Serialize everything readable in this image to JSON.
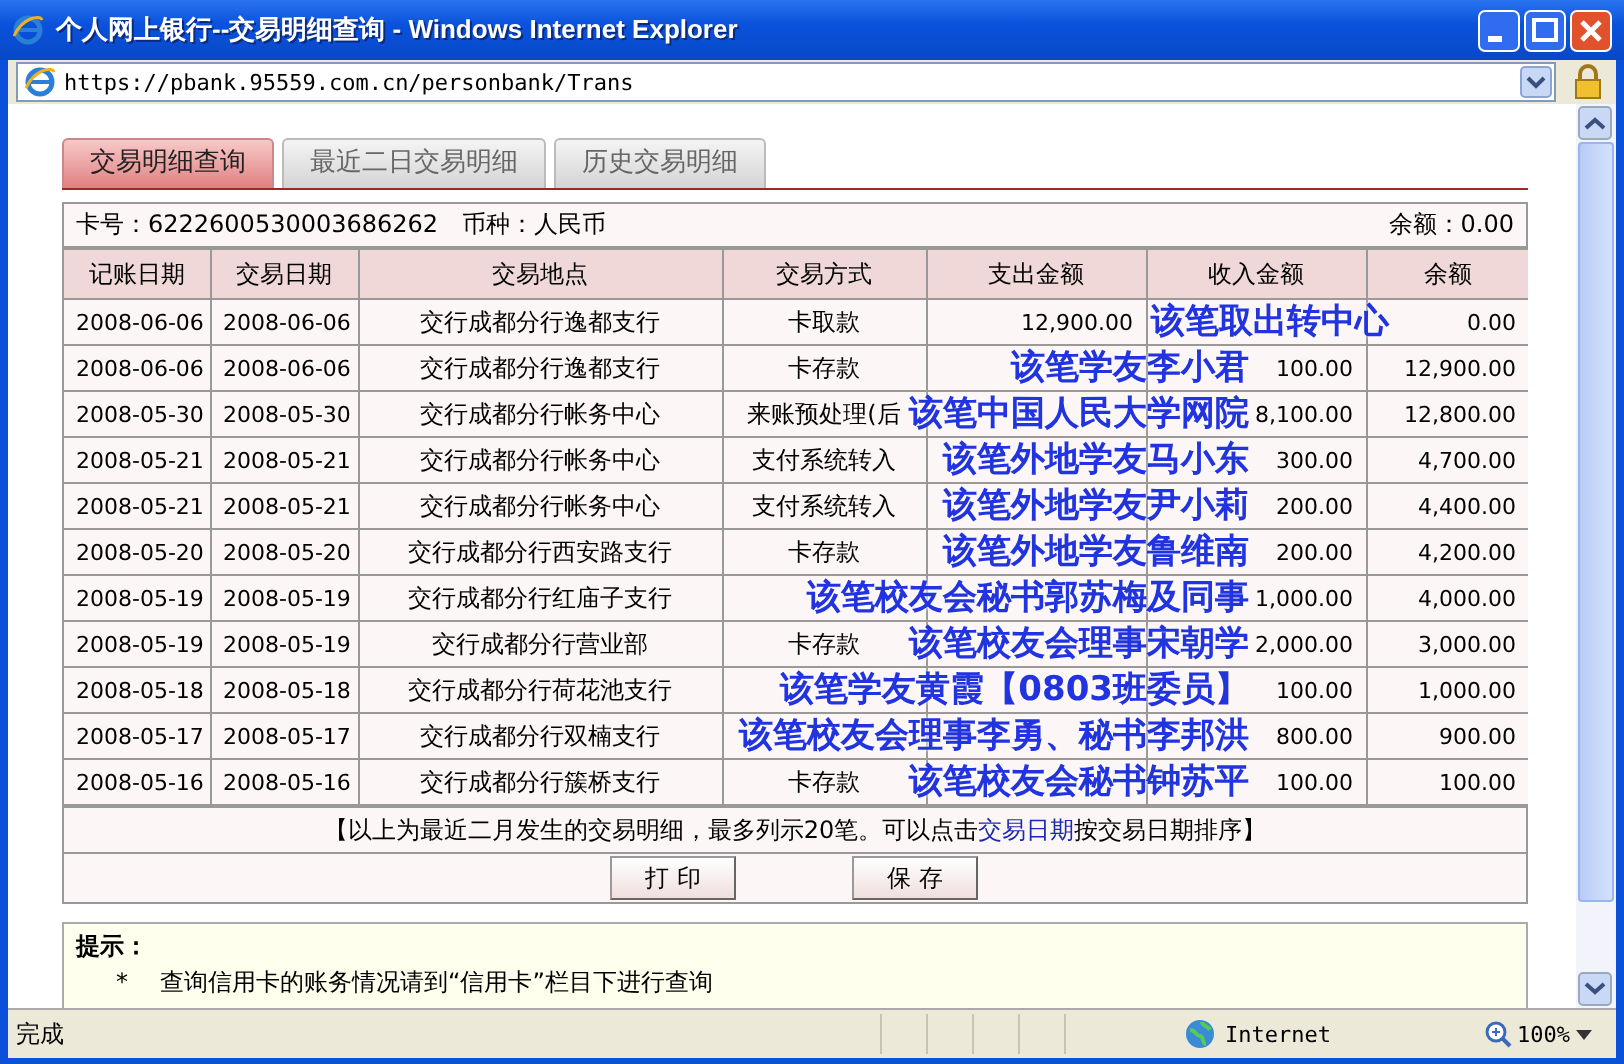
{
  "window": {
    "title": "个人网上银行--交易明细查询 - Windows Internet Explorer"
  },
  "address_bar": {
    "url": "https://pbank.95559.com.cn/personbank/Trans"
  },
  "tabs": [
    {
      "label": "交易明细查询",
      "selected": true
    },
    {
      "label": "最近二日交易明细",
      "selected": false
    },
    {
      "label": "历史交易明细",
      "selected": false
    }
  ],
  "account": {
    "card": "卡号：6222600530003686262",
    "currency": "币种：人民币",
    "balance": "余额：0.00"
  },
  "table": {
    "columns": [
      "记账日期",
      "交易日期",
      "交易地点",
      "交易方式",
      "支出金额",
      "收入金额",
      "余额"
    ],
    "rows": [
      {
        "posting_date": "2008-06-06",
        "trade_date": "2008-06-06",
        "place": "交行成都分行逸都支行",
        "method": "卡取款",
        "expense": "12,900.00",
        "balance": "0.00",
        "note": {
          "text": "该笔取出转中心",
          "kind": "over_income"
        }
      },
      {
        "posting_date": "2008-06-06",
        "trade_date": "2008-06-06",
        "place": "交行成都分行逸都支行",
        "method": "卡存款",
        "income": "100.00",
        "balance": "12,900.00",
        "note": {
          "text": "该笔学友李小君",
          "kind": "before_income"
        }
      },
      {
        "posting_date": "2008-05-30",
        "trade_date": "2008-05-30",
        "place": "交行成都分行帐务中心",
        "method": "来账预处理(后",
        "income": "8,100.00",
        "balance": "12,800.00",
        "note": {
          "text": "该笔中国人民大学网院",
          "kind": "before_income"
        }
      },
      {
        "posting_date": "2008-05-21",
        "trade_date": "2008-05-21",
        "place": "交行成都分行帐务中心",
        "method": "支付系统转入",
        "income": "300.00",
        "balance": "4,700.00",
        "note": {
          "text": "该笔外地学友马小东",
          "kind": "before_income"
        }
      },
      {
        "posting_date": "2008-05-21",
        "trade_date": "2008-05-21",
        "place": "交行成都分行帐务中心",
        "method": "支付系统转入",
        "income": "200.00",
        "balance": "4,400.00",
        "note": {
          "text": "该笔外地学友尹小莉",
          "kind": "before_income"
        }
      },
      {
        "posting_date": "2008-05-20",
        "trade_date": "2008-05-20",
        "place": "交行成都分行西安路支行",
        "method": "卡存款",
        "income": "200.00",
        "balance": "4,200.00",
        "note": {
          "text": "该笔外地学友鲁维南",
          "kind": "before_income"
        }
      },
      {
        "posting_date": "2008-05-19",
        "trade_date": "2008-05-19",
        "place": "交行成都分行红庙子支行",
        "income": "1,000.00",
        "balance": "4,000.00",
        "note": {
          "text": "该笔校友会秘书郭苏梅及同事",
          "kind": "before_income"
        }
      },
      {
        "posting_date": "2008-05-19",
        "trade_date": "2008-05-19",
        "place": "交行成都分行营业部",
        "method": "卡存款",
        "income": "2,000.00",
        "balance": "3,000.00",
        "note": {
          "text": "该笔校友会理事宋朝学",
          "kind": "before_income"
        }
      },
      {
        "posting_date": "2008-05-18",
        "trade_date": "2008-05-18",
        "place": "交行成都分行荷花池支行",
        "income": "100.00",
        "balance": "1,000.00",
        "note": {
          "text": "该笔学友黄霞【0803班委员】",
          "kind": "before_income"
        }
      },
      {
        "posting_date": "2008-05-17",
        "trade_date": "2008-05-17",
        "place": "交行成都分行双楠支行",
        "income": "800.00",
        "balance": "900.00",
        "note": {
          "text": "该笔校友会理事李勇、秘书李邦洪",
          "kind": "before_income"
        }
      },
      {
        "posting_date": "2008-05-16",
        "trade_date": "2008-05-16",
        "place": "交行成都分行簇桥支行",
        "method": "卡存款",
        "income": "100.00",
        "balance": "100.00",
        "note": {
          "text": "该笔校友会秘书钟苏平",
          "kind": "before_income"
        }
      }
    ]
  },
  "footnote": {
    "before": "【以上为最近二月发生的交易明细，最多列示20笔。可以点击",
    "link": "交易日期",
    "after": "按交易日期排序】"
  },
  "buttons": [
    "打 印",
    "保 存"
  ],
  "tips": {
    "title": "提示：",
    "items": [
      {
        "marker": "*",
        "text": "查询信用卡的账务情况请到“信用卡”栏目下进行查询"
      }
    ]
  },
  "status_bar": {
    "text": "完成",
    "zone": "Internet",
    "zoom": "100%"
  }
}
